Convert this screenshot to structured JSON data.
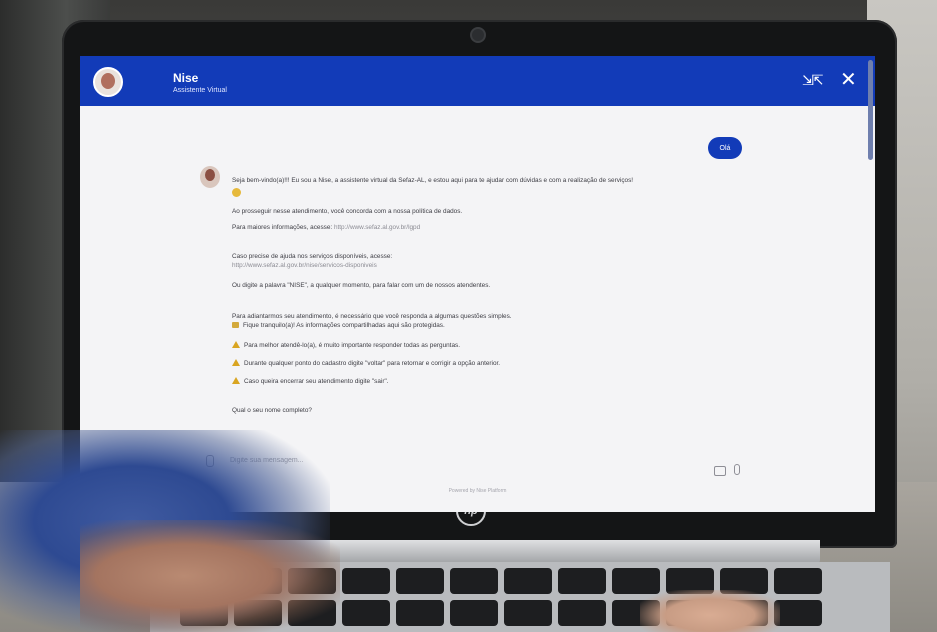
{
  "header": {
    "bot_name": "Nise",
    "bot_subtitle": "Assistente Virtual",
    "minimize_icon": "minimize-icon",
    "close_icon": "close-icon",
    "accent_color": "#123bb8"
  },
  "user_message": "Olá",
  "bot_messages": {
    "welcome": "Seja bem-vindo(a)!!! Eu sou a Nise, a assistente virtual da Sefaz-AL, e estou aqui para te ajudar com dúvidas e com a realização de serviços!",
    "privacy": "Ao prosseguir nesse atendimento, você concorda com a nossa política de dados.",
    "more_info": "Para maiores informações, acesse:",
    "more_info_link": "http://www.sefaz.al.gov.br/lgpd",
    "services_help": "Caso precise de ajuda nos serviços disponíveis, acesse:",
    "services_link": "http://www.sefaz.al.gov.br/nise/servicos-disponiveis",
    "keyword_tip": "Ou digite a palavra \"NISE\", a qualquer momento, para falar com um de nossos atendentes.",
    "questions_intro": "Para adiantarmos seu atendimento, é necessário que você responda a algumas questões simples.",
    "safety_note": "Fique tranquilo(a)! As informações compartilhadas aqui são protegidas.",
    "warnings": [
      "Para melhor atendê-lo(a), é muito importante responder todas as perguntas.",
      "Durante qualquer ponto do cadastro digite \"voltar\" para retornar e corrigir a opção anterior.",
      "Caso queira encerrar seu atendimento digite \"sair\"."
    ],
    "name_question": "Qual o seu nome completo?"
  },
  "input": {
    "placeholder": "Digite sua mensagem..."
  },
  "footer": {
    "powered_by": "Powered by Nise Platform"
  },
  "device": {
    "logo_text": "hp"
  }
}
